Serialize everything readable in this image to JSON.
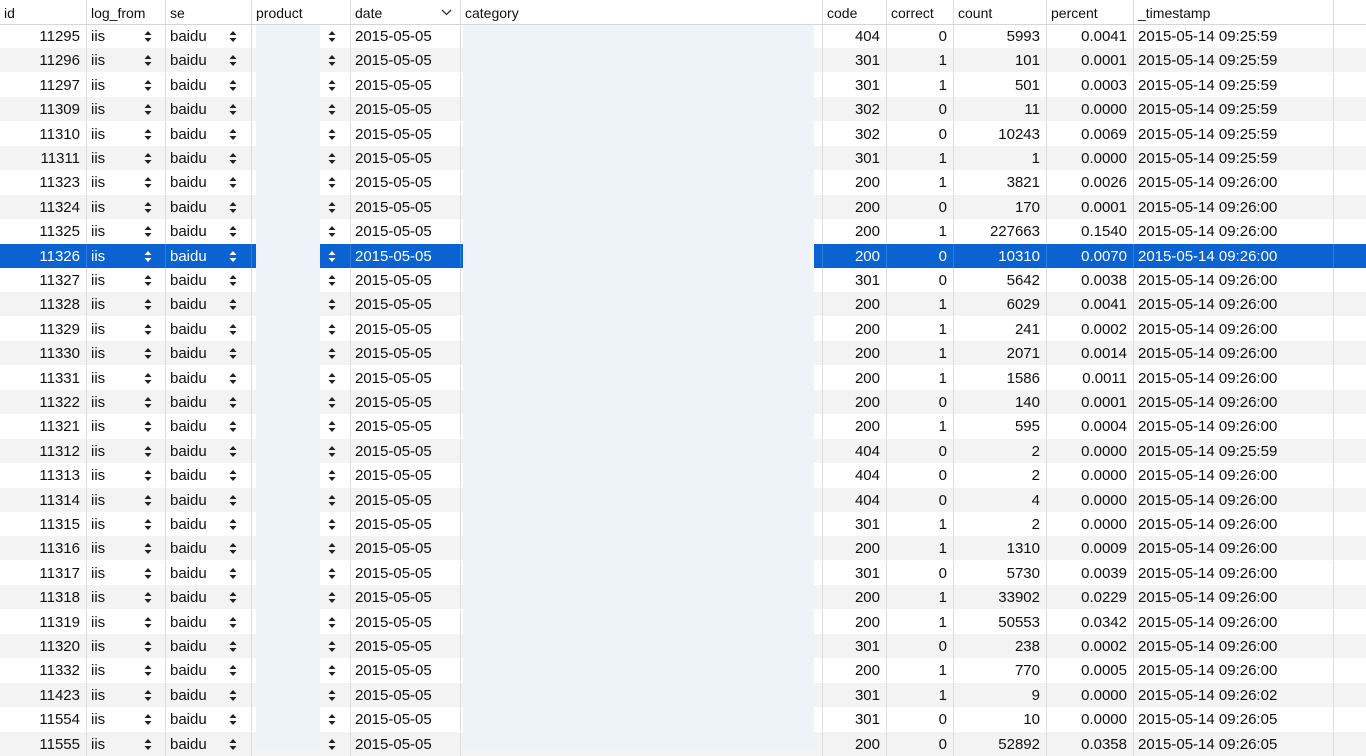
{
  "columns": [
    {
      "key": "id",
      "label": "id"
    },
    {
      "key": "log_from",
      "label": "log_from"
    },
    {
      "key": "se",
      "label": "se"
    },
    {
      "key": "product",
      "label": "product"
    },
    {
      "key": "date",
      "label": "date"
    },
    {
      "key": "category",
      "label": "category"
    },
    {
      "key": "code",
      "label": "code"
    },
    {
      "key": "correct",
      "label": "correct"
    },
    {
      "key": "count",
      "label": "count"
    },
    {
      "key": "percent",
      "label": "percent"
    },
    {
      "key": "_timestamp",
      "label": "_timestamp"
    }
  ],
  "sort_icon": "chevron-down-icon",
  "selected_row_index": 9,
  "colors": {
    "selection": "#0b63d1",
    "stripe": "#f3f3f3",
    "redaction": "#eef2f9"
  },
  "rows": [
    {
      "id": "11295",
      "log_from": "iis",
      "se": "baidu",
      "date": "2015-05-05",
      "code": "404",
      "correct": "0",
      "count": "5993",
      "percent": "0.0041",
      "_timestamp": "2015-05-14 09:25:59"
    },
    {
      "id": "11296",
      "log_from": "iis",
      "se": "baidu",
      "date": "2015-05-05",
      "code": "301",
      "correct": "1",
      "count": "101",
      "percent": "0.0001",
      "_timestamp": "2015-05-14 09:25:59"
    },
    {
      "id": "11297",
      "log_from": "iis",
      "se": "baidu",
      "date": "2015-05-05",
      "code": "301",
      "correct": "1",
      "count": "501",
      "percent": "0.0003",
      "_timestamp": "2015-05-14 09:25:59"
    },
    {
      "id": "11309",
      "log_from": "iis",
      "se": "baidu",
      "date": "2015-05-05",
      "code": "302",
      "correct": "0",
      "count": "11",
      "percent": "0.0000",
      "_timestamp": "2015-05-14 09:25:59"
    },
    {
      "id": "11310",
      "log_from": "iis",
      "se": "baidu",
      "date": "2015-05-05",
      "code": "302",
      "correct": "0",
      "count": "10243",
      "percent": "0.0069",
      "_timestamp": "2015-05-14 09:25:59"
    },
    {
      "id": "11311",
      "log_from": "iis",
      "se": "baidu",
      "date": "2015-05-05",
      "code": "301",
      "correct": "1",
      "count": "1",
      "percent": "0.0000",
      "_timestamp": "2015-05-14 09:25:59"
    },
    {
      "id": "11323",
      "log_from": "iis",
      "se": "baidu",
      "date": "2015-05-05",
      "code": "200",
      "correct": "1",
      "count": "3821",
      "percent": "0.0026",
      "_timestamp": "2015-05-14 09:26:00"
    },
    {
      "id": "11324",
      "log_from": "iis",
      "se": "baidu",
      "date": "2015-05-05",
      "code": "200",
      "correct": "0",
      "count": "170",
      "percent": "0.0001",
      "_timestamp": "2015-05-14 09:26:00"
    },
    {
      "id": "11325",
      "log_from": "iis",
      "se": "baidu",
      "date": "2015-05-05",
      "code": "200",
      "correct": "1",
      "count": "227663",
      "percent": "0.1540",
      "_timestamp": "2015-05-14 09:26:00"
    },
    {
      "id": "11326",
      "log_from": "iis",
      "se": "baidu",
      "date": "2015-05-05",
      "code": "200",
      "correct": "0",
      "count": "10310",
      "percent": "0.0070",
      "_timestamp": "2015-05-14 09:26:00"
    },
    {
      "id": "11327",
      "log_from": "iis",
      "se": "baidu",
      "date": "2015-05-05",
      "code": "301",
      "correct": "0",
      "count": "5642",
      "percent": "0.0038",
      "_timestamp": "2015-05-14 09:26:00"
    },
    {
      "id": "11328",
      "log_from": "iis",
      "se": "baidu",
      "date": "2015-05-05",
      "code": "200",
      "correct": "1",
      "count": "6029",
      "percent": "0.0041",
      "_timestamp": "2015-05-14 09:26:00"
    },
    {
      "id": "11329",
      "log_from": "iis",
      "se": "baidu",
      "date": "2015-05-05",
      "code": "200",
      "correct": "1",
      "count": "241",
      "percent": "0.0002",
      "_timestamp": "2015-05-14 09:26:00"
    },
    {
      "id": "11330",
      "log_from": "iis",
      "se": "baidu",
      "date": "2015-05-05",
      "code": "200",
      "correct": "1",
      "count": "2071",
      "percent": "0.0014",
      "_timestamp": "2015-05-14 09:26:00"
    },
    {
      "id": "11331",
      "log_from": "iis",
      "se": "baidu",
      "date": "2015-05-05",
      "code": "200",
      "correct": "1",
      "count": "1586",
      "percent": "0.0011",
      "_timestamp": "2015-05-14 09:26:00"
    },
    {
      "id": "11322",
      "log_from": "iis",
      "se": "baidu",
      "date": "2015-05-05",
      "code": "200",
      "correct": "0",
      "count": "140",
      "percent": "0.0001",
      "_timestamp": "2015-05-14 09:26:00"
    },
    {
      "id": "11321",
      "log_from": "iis",
      "se": "baidu",
      "date": "2015-05-05",
      "code": "200",
      "correct": "1",
      "count": "595",
      "percent": "0.0004",
      "_timestamp": "2015-05-14 09:26:00"
    },
    {
      "id": "11312",
      "log_from": "iis",
      "se": "baidu",
      "date": "2015-05-05",
      "code": "404",
      "correct": "0",
      "count": "2",
      "percent": "0.0000",
      "_timestamp": "2015-05-14 09:25:59"
    },
    {
      "id": "11313",
      "log_from": "iis",
      "se": "baidu",
      "date": "2015-05-05",
      "code": "404",
      "correct": "0",
      "count": "2",
      "percent": "0.0000",
      "_timestamp": "2015-05-14 09:26:00"
    },
    {
      "id": "11314",
      "log_from": "iis",
      "se": "baidu",
      "date": "2015-05-05",
      "code": "404",
      "correct": "0",
      "count": "4",
      "percent": "0.0000",
      "_timestamp": "2015-05-14 09:26:00"
    },
    {
      "id": "11315",
      "log_from": "iis",
      "se": "baidu",
      "date": "2015-05-05",
      "code": "301",
      "correct": "1",
      "count": "2",
      "percent": "0.0000",
      "_timestamp": "2015-05-14 09:26:00"
    },
    {
      "id": "11316",
      "log_from": "iis",
      "se": "baidu",
      "date": "2015-05-05",
      "code": "200",
      "correct": "1",
      "count": "1310",
      "percent": "0.0009",
      "_timestamp": "2015-05-14 09:26:00"
    },
    {
      "id": "11317",
      "log_from": "iis",
      "se": "baidu",
      "date": "2015-05-05",
      "code": "301",
      "correct": "0",
      "count": "5730",
      "percent": "0.0039",
      "_timestamp": "2015-05-14 09:26:00"
    },
    {
      "id": "11318",
      "log_from": "iis",
      "se": "baidu",
      "date": "2015-05-05",
      "code": "200",
      "correct": "1",
      "count": "33902",
      "percent": "0.0229",
      "_timestamp": "2015-05-14 09:26:00"
    },
    {
      "id": "11319",
      "log_from": "iis",
      "se": "baidu",
      "date": "2015-05-05",
      "code": "200",
      "correct": "1",
      "count": "50553",
      "percent": "0.0342",
      "_timestamp": "2015-05-14 09:26:00"
    },
    {
      "id": "11320",
      "log_from": "iis",
      "se": "baidu",
      "date": "2015-05-05",
      "code": "301",
      "correct": "0",
      "count": "238",
      "percent": "0.0002",
      "_timestamp": "2015-05-14 09:26:00"
    },
    {
      "id": "11332",
      "log_from": "iis",
      "se": "baidu",
      "date": "2015-05-05",
      "code": "200",
      "correct": "1",
      "count": "770",
      "percent": "0.0005",
      "_timestamp": "2015-05-14 09:26:00"
    },
    {
      "id": "11423",
      "log_from": "iis",
      "se": "baidu",
      "date": "2015-05-05",
      "code": "301",
      "correct": "1",
      "count": "9",
      "percent": "0.0000",
      "_timestamp": "2015-05-14 09:26:02"
    },
    {
      "id": "11554",
      "log_from": "iis",
      "se": "baidu",
      "date": "2015-05-05",
      "code": "301",
      "correct": "0",
      "count": "10",
      "percent": "0.0000",
      "_timestamp": "2015-05-14 09:26:05"
    },
    {
      "id": "11555",
      "log_from": "iis",
      "se": "baidu",
      "date": "2015-05-05",
      "code": "200",
      "correct": "0",
      "count": "52892",
      "percent": "0.0358",
      "_timestamp": "2015-05-14 09:26:05"
    }
  ]
}
